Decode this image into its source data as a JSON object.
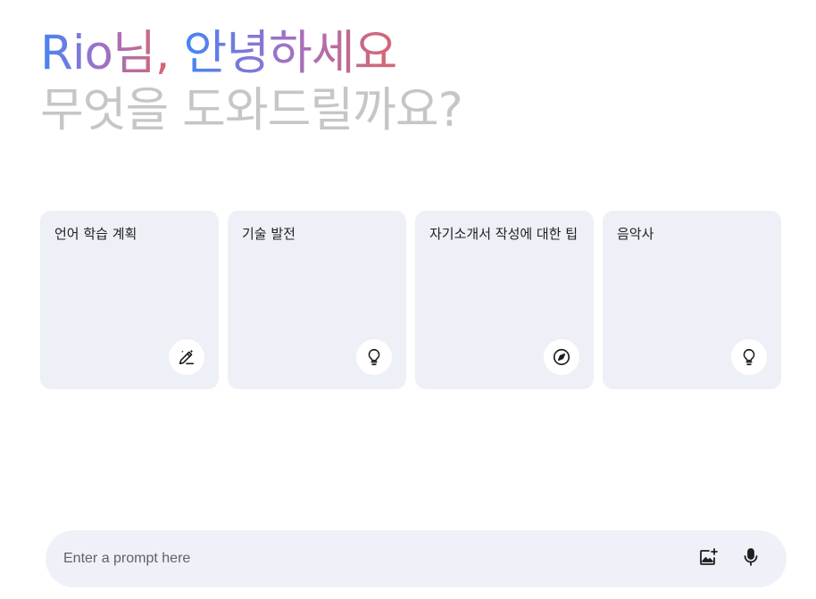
{
  "greeting": {
    "name": "Rio님,",
    "hello": "안녕하세요",
    "subtitle": "무엇을 도와드릴까요?"
  },
  "cards": [
    {
      "label": "언어 학습 계획",
      "icon": "pencil-sparkle-icon"
    },
    {
      "label": "기술 발전",
      "icon": "lightbulb-icon"
    },
    {
      "label": "자기소개서 작성에 대한 팁",
      "icon": "compass-icon"
    },
    {
      "label": "음악사",
      "icon": "lightbulb-icon"
    }
  ],
  "prompt": {
    "placeholder": "Enter a prompt here",
    "image_button_icon": "add-image-icon",
    "mic_button_icon": "microphone-icon"
  },
  "colors": {
    "gradient_start": "#4285f4",
    "gradient_mid": "#9b72cb",
    "gradient_end": "#d96570",
    "subtitle": "#c4c7c5",
    "card_bg": "#edf0f7",
    "prompt_bg": "#eef1f8"
  }
}
